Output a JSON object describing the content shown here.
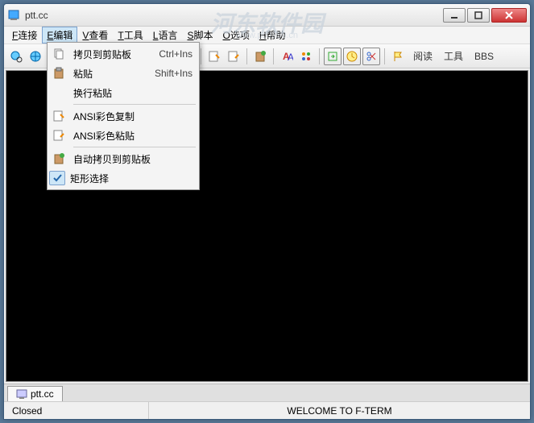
{
  "watermark": {
    "main": "河东软件园",
    "sub": "www.pc0359.cn"
  },
  "window": {
    "title": "ptt.cc"
  },
  "menubar": [
    {
      "key": "F",
      "label": "连接"
    },
    {
      "key": "E",
      "label": "编辑",
      "active": true
    },
    {
      "key": "V",
      "label": "查看"
    },
    {
      "key": "T",
      "label": "工具"
    },
    {
      "key": "L",
      "label": "语言"
    },
    {
      "key": "S",
      "label": "脚本"
    },
    {
      "key": "O",
      "label": "选项"
    },
    {
      "key": "H",
      "label": "帮助"
    }
  ],
  "dropdown": [
    {
      "icon": "copy-icon",
      "label": "拷贝到剪贴板",
      "shortcut": "Ctrl+Ins"
    },
    {
      "icon": "paste-icon",
      "label": "粘贴",
      "shortcut": "Shift+Ins"
    },
    {
      "icon": "",
      "label": "换行粘贴",
      "shortcut": ""
    },
    {
      "sep": true
    },
    {
      "icon": "ansi-copy-icon",
      "label": "ANSI彩色复制",
      "shortcut": ""
    },
    {
      "icon": "ansi-paste-icon",
      "label": "ANSI彩色粘贴",
      "shortcut": ""
    },
    {
      "sep": true
    },
    {
      "icon": "auto-copy-icon",
      "label": "自动拷贝到剪贴板",
      "shortcut": ""
    },
    {
      "icon": "check",
      "label": "矩形选择",
      "shortcut": "",
      "checked": true
    }
  ],
  "toolbar_text": {
    "read": "阅读",
    "tools": "工具",
    "bbs": "BBS"
  },
  "tab": {
    "label": "ptt.cc"
  },
  "status": {
    "state": "Closed",
    "message": "WELCOME TO F-TERM"
  }
}
